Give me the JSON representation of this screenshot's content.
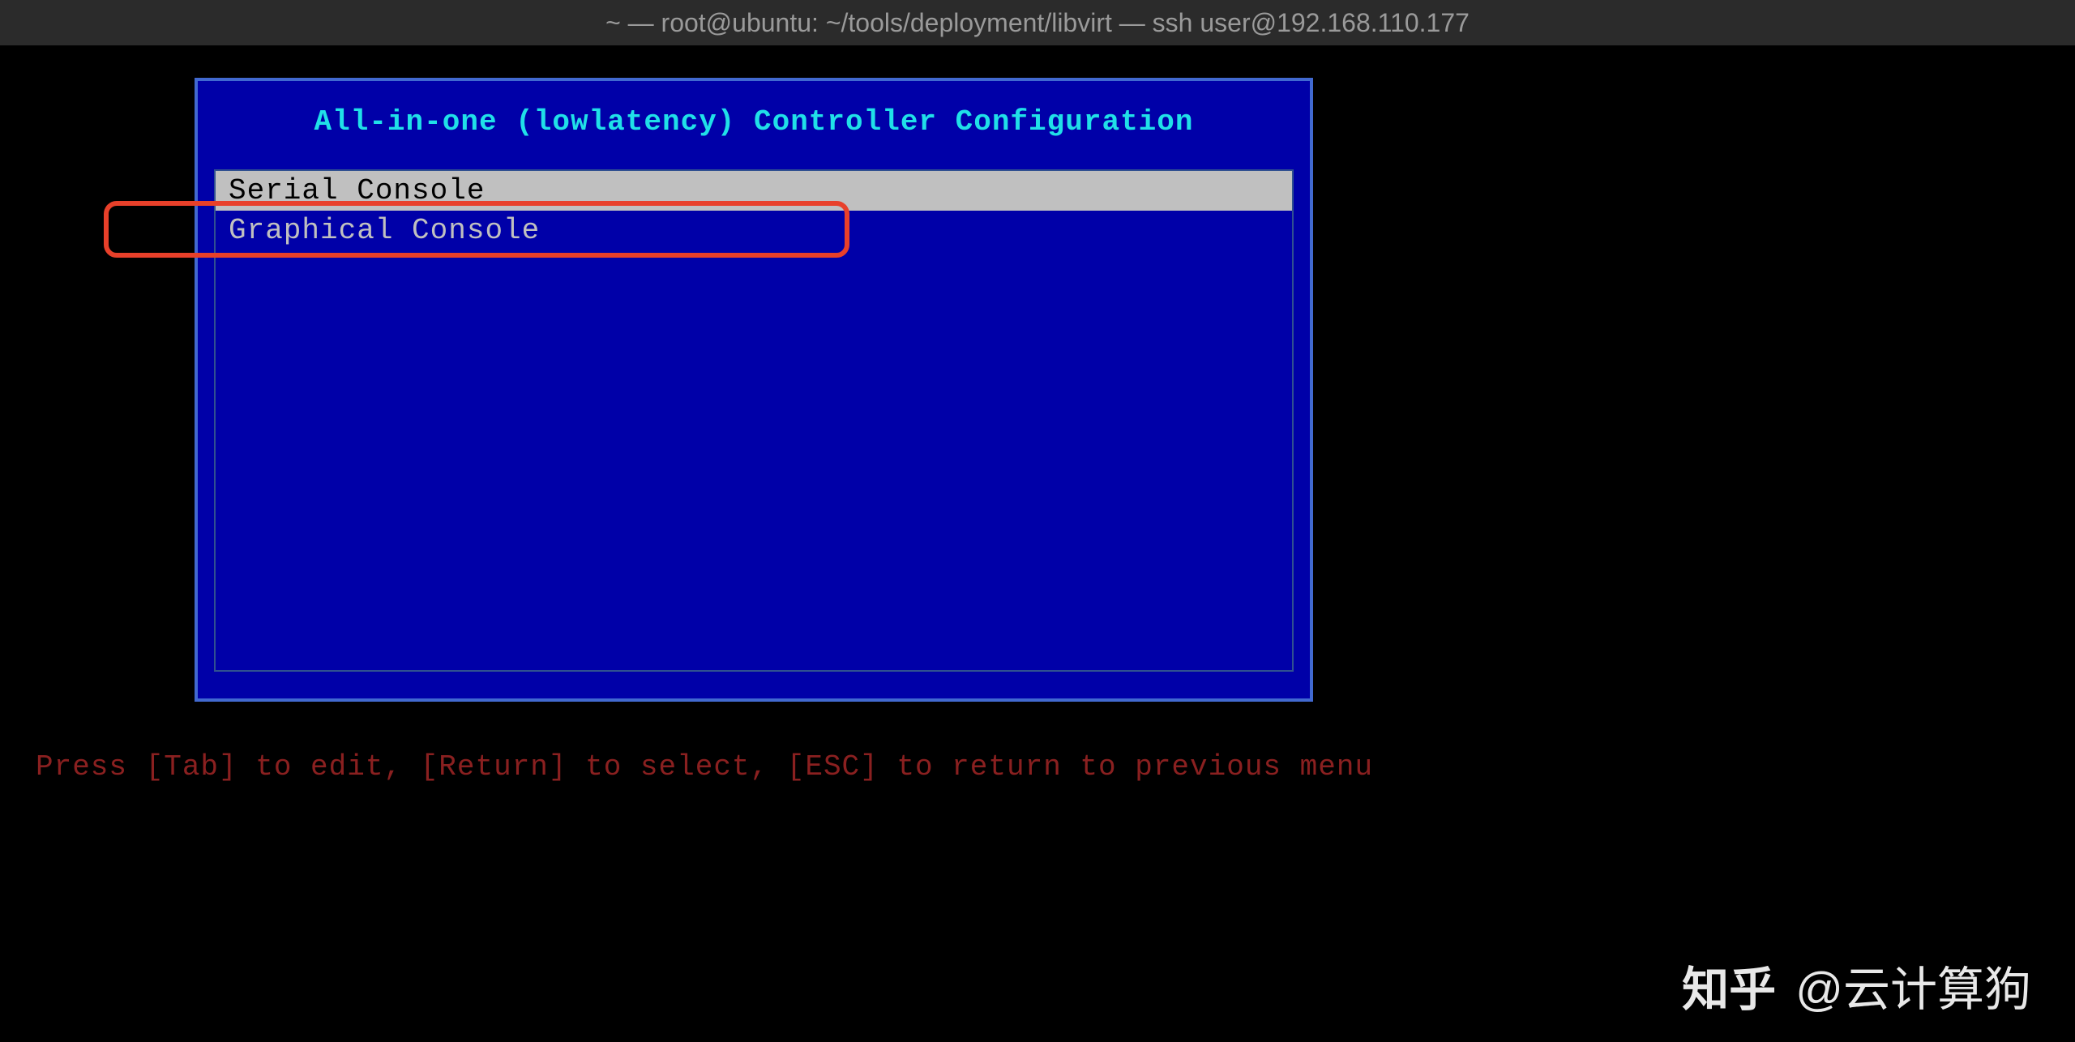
{
  "titlebar": "~ — root@ubuntu: ~/tools/deployment/libvirt — ssh user@192.168.110.177",
  "menu": {
    "title": "All-in-one (lowlatency) Controller Configuration",
    "items": [
      {
        "label": "Serial Console",
        "selected": true
      },
      {
        "label": "Graphical Console",
        "selected": false
      }
    ]
  },
  "hint": "Press [Tab] to edit, [Return] to select, [ESC] to return to previous menu",
  "watermark": {
    "logo": "知乎",
    "author": "@云计算狗"
  }
}
